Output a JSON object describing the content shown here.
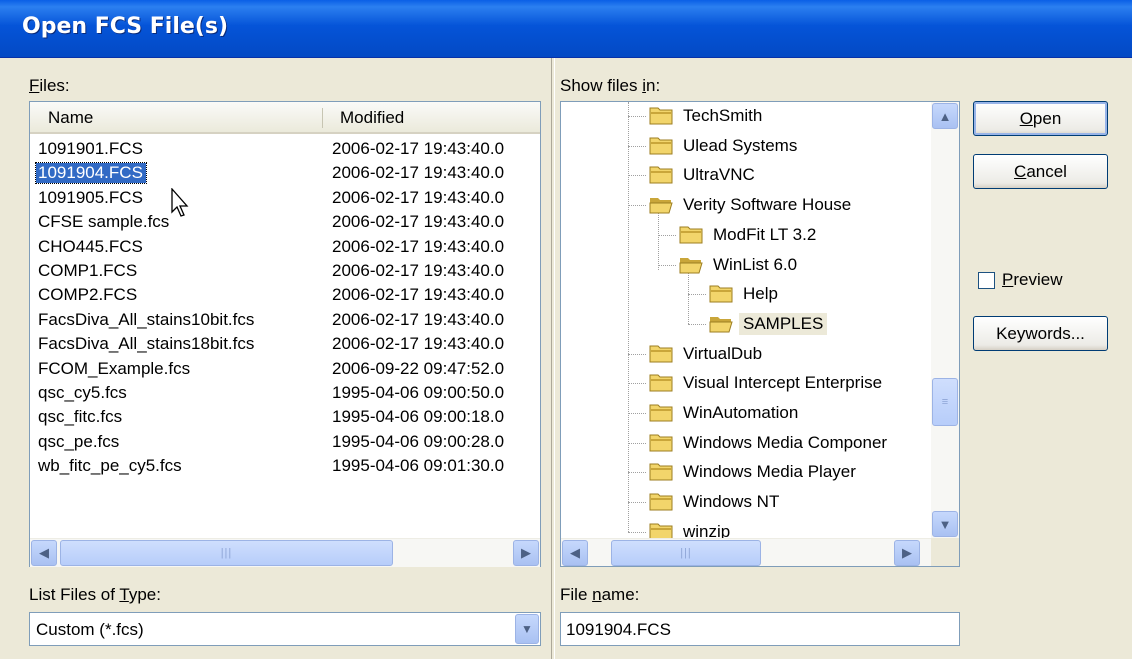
{
  "window": {
    "title": "Open FCS File(s)"
  },
  "files": {
    "label_prefix": "",
    "label_underline": "F",
    "label_rest": "iles:",
    "columns": {
      "name": "Name",
      "modified": "Modified"
    },
    "rows": [
      {
        "name": "1091901.FCS",
        "modified": "2006-02-17 19:43:40.0"
      },
      {
        "name": "1091904.FCS",
        "modified": "2006-02-17 19:43:40.0",
        "selected": true
      },
      {
        "name": "1091905.FCS",
        "modified": "2006-02-17 19:43:40.0"
      },
      {
        "name": "CFSE sample.fcs",
        "modified": "2006-02-17 19:43:40.0"
      },
      {
        "name": "CHO445.FCS",
        "modified": "2006-02-17 19:43:40.0"
      },
      {
        "name": "COMP1.FCS",
        "modified": "2006-02-17 19:43:40.0"
      },
      {
        "name": "COMP2.FCS",
        "modified": "2006-02-17 19:43:40.0"
      },
      {
        "name": "FacsDiva_All_stains10bit.fcs",
        "modified": "2006-02-17 19:43:40.0"
      },
      {
        "name": "FacsDiva_All_stains18bit.fcs",
        "modified": "2006-02-17 19:43:40.0"
      },
      {
        "name": "FCOM_Example.fcs",
        "modified": "2006-09-22 09:47:52.0"
      },
      {
        "name": "qsc_cy5.fcs",
        "modified": "1995-04-06 09:00:50.0"
      },
      {
        "name": "qsc_fitc.fcs",
        "modified": "1995-04-06 09:00:18.0"
      },
      {
        "name": "qsc_pe.fcs",
        "modified": "1995-04-06 09:00:28.0"
      },
      {
        "name": "wb_fitc_pe_cy5.fcs",
        "modified": "1995-04-06 09:01:30.0"
      }
    ]
  },
  "file_type": {
    "label_prefix": "List Files of ",
    "label_underline": "T",
    "label_rest": "ype:",
    "value": "Custom (*.fcs)"
  },
  "folders": {
    "label_prefix": "Show files ",
    "label_underline": "i",
    "label_rest": "n:",
    "items": [
      {
        "name": "TechSmith",
        "level": 0
      },
      {
        "name": "Ulead Systems",
        "level": 0
      },
      {
        "name": "UltraVNC",
        "level": 0
      },
      {
        "name": "Verity Software House",
        "level": 0,
        "open": true
      },
      {
        "name": "ModFit LT 3.2",
        "level": 1
      },
      {
        "name": "WinList 6.0",
        "level": 1,
        "open": true
      },
      {
        "name": "Help",
        "level": 2
      },
      {
        "name": "SAMPLES",
        "level": 2,
        "open": true,
        "selected": true
      },
      {
        "name": "VirtualDub",
        "level": 0
      },
      {
        "name": "Visual Intercept Enterprise",
        "level": 0
      },
      {
        "name": "WinAutomation",
        "level": 0
      },
      {
        "name": "Windows Media Componer",
        "level": 0
      },
      {
        "name": "Windows Media Player",
        "level": 0
      },
      {
        "name": "Windows NT",
        "level": 0
      },
      {
        "name": "winzip",
        "level": 0
      }
    ]
  },
  "file_name": {
    "label_prefix": "File ",
    "label_underline": "n",
    "label_rest": "ame:",
    "value": "1091904.FCS"
  },
  "buttons": {
    "open": {
      "u": "O",
      "rest": "pen"
    },
    "cancel": {
      "u": "C",
      "rest": "ancel"
    },
    "keywords": "Keywords..."
  },
  "preview": {
    "u": "P",
    "rest": "review",
    "checked": false
  },
  "colors": {
    "title_bar": "#0554d8",
    "selection": "#316ac5",
    "face": "#ece9d8",
    "folder_yellow": "#f2d56b"
  }
}
